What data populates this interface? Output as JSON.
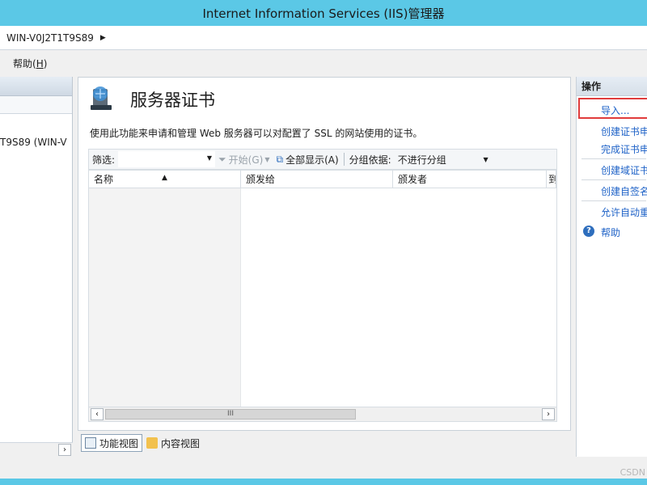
{
  "window": {
    "title": "Internet Information Services (IIS)管理器"
  },
  "address": {
    "path": "WIN-V0J2T1T9S89"
  },
  "menu": {
    "help_label": "帮助(",
    "help_key": "H",
    "help_close": ")"
  },
  "connections": {
    "tree_node": "T9S89 (WIN-V"
  },
  "feature": {
    "title": "服务器证书",
    "description": "使用此功能来申请和管理 Web 服务器可以对配置了 SSL 的网站使用的证书。",
    "icon": "server-certificate-icon"
  },
  "toolbar": {
    "filter_label": "筛选:",
    "start_label": "开始(G)",
    "show_all_label": "全部显示(A)",
    "group_by_label": "分组依据:",
    "group_value": "不进行分组"
  },
  "grid": {
    "columns": [
      "名称",
      "颁发给",
      "颁发者",
      "到"
    ]
  },
  "hscroll": {
    "thumb_glyph": "III"
  },
  "views": {
    "features_view": "功能视图",
    "content_view": "内容视图"
  },
  "actions": {
    "header": "操作",
    "import": "导入...",
    "create_request": "创建证书申请",
    "complete_request": "完成证书申请",
    "create_domain_cert": "创建域证书",
    "create_self_signed": "创建自签名证书",
    "enable_auto": "允许自动重新绑定",
    "help": "帮助"
  },
  "watermark": "CSDN",
  "colors": {
    "titlebar": "#5bc8e6",
    "link": "#1e62c7",
    "highlight_box": "#e03c3c"
  }
}
